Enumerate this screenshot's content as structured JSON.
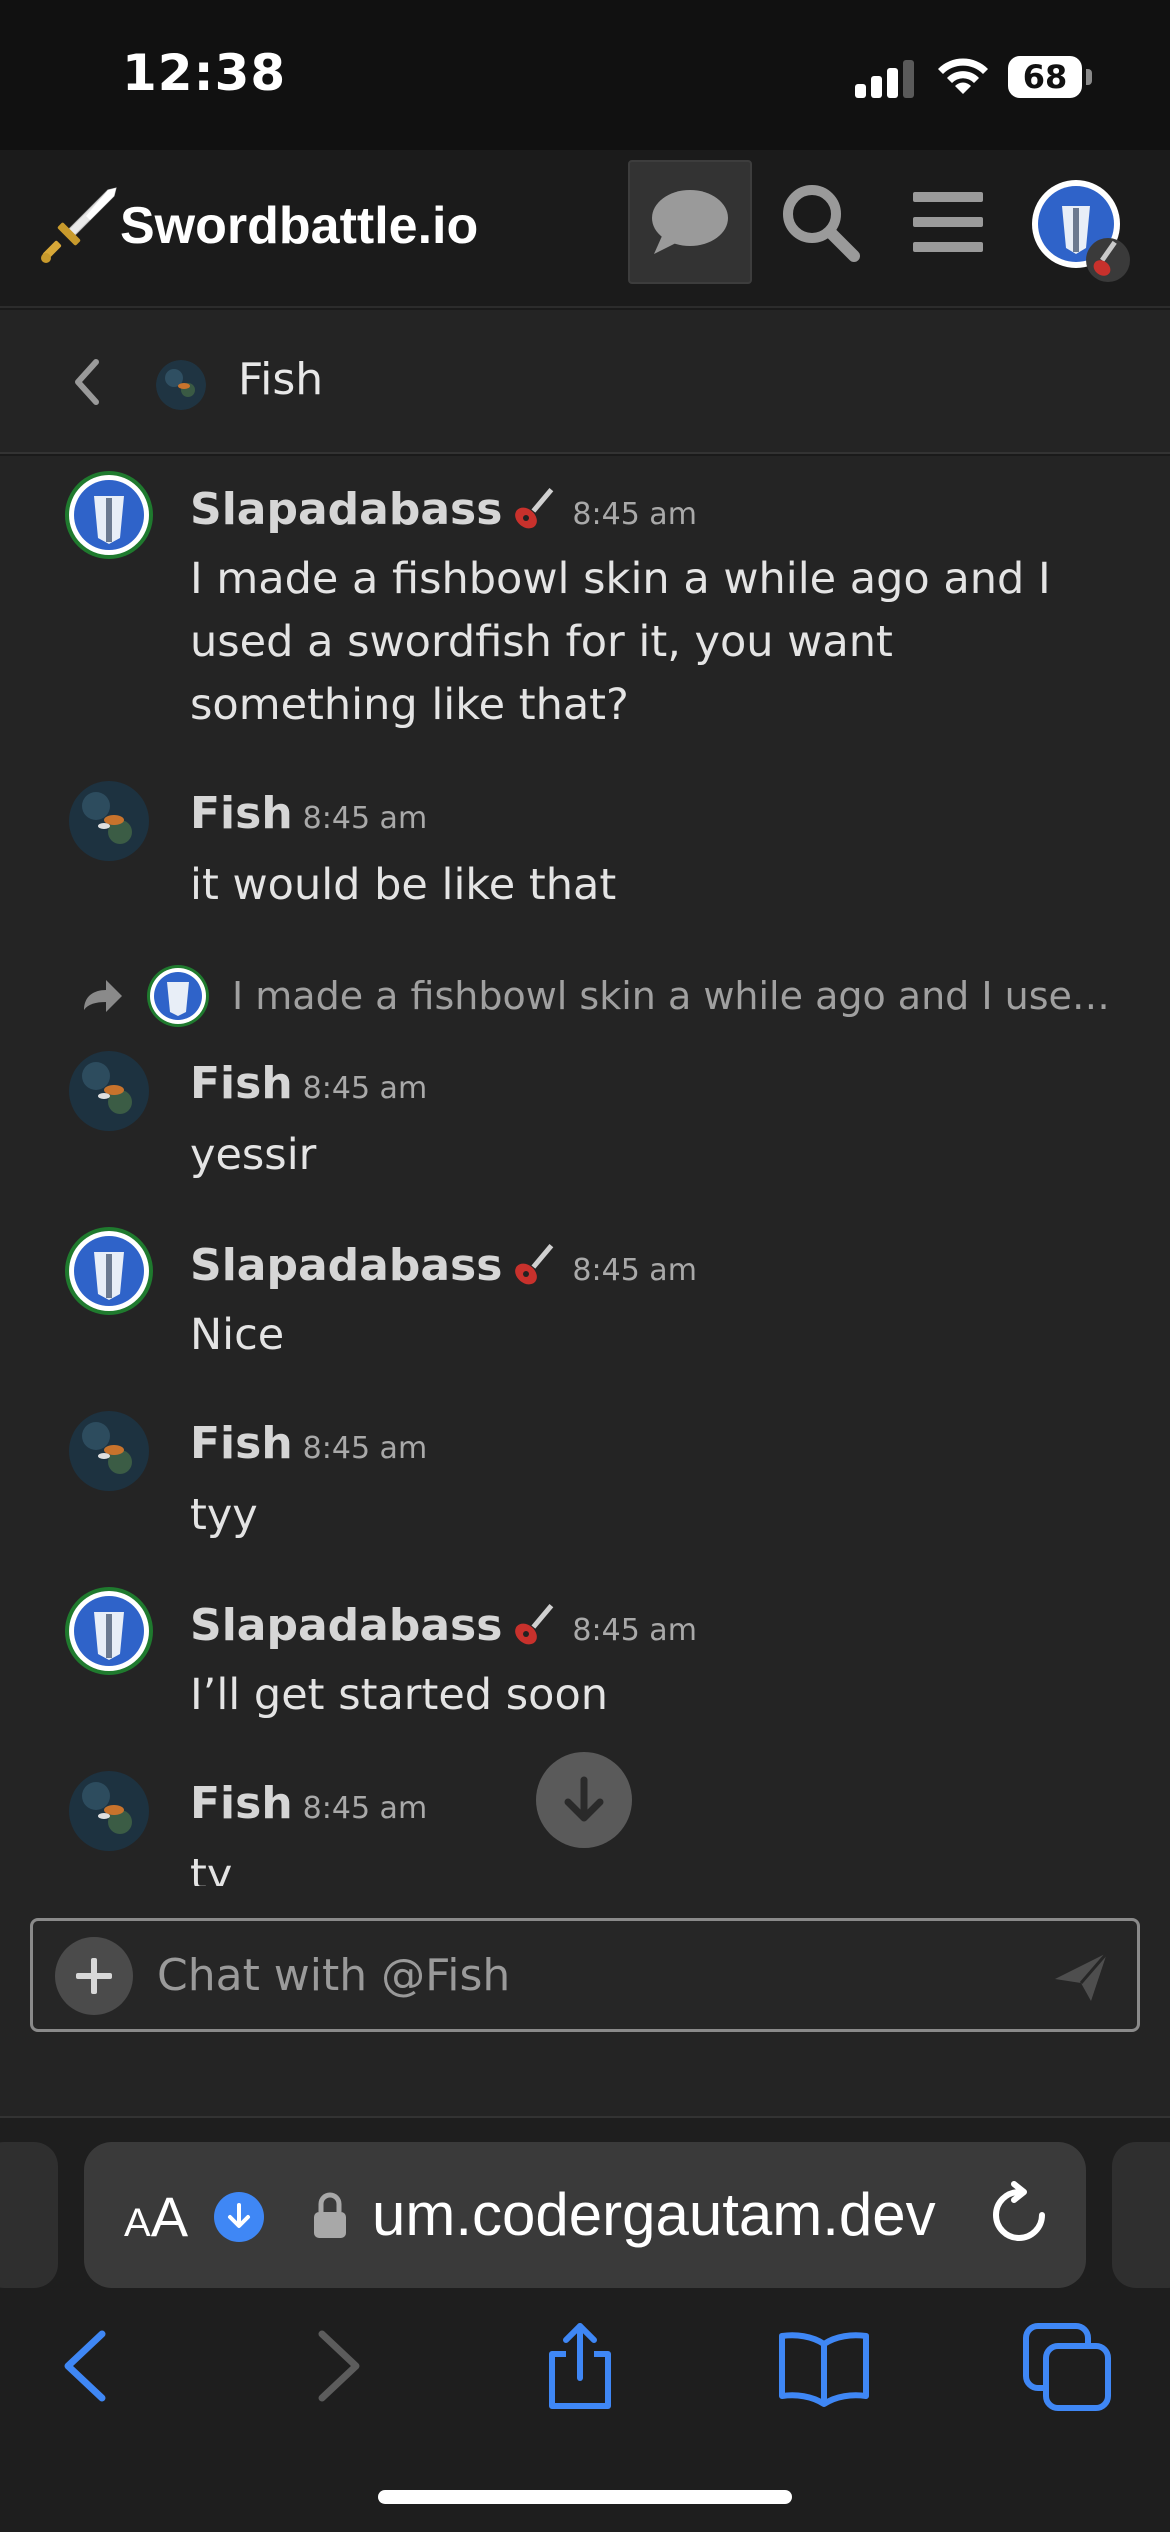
{
  "status_bar": {
    "time": "12:38",
    "battery_percent": "68",
    "signal_bars": 3,
    "icons": [
      "signal-icon",
      "wifi-icon",
      "battery-icon"
    ]
  },
  "forum_header": {
    "brand": "Swordbattle.io",
    "buttons": [
      "chat-icon",
      "search-icon",
      "hamburger-menu-icon",
      "user-avatar"
    ]
  },
  "channel": {
    "title": "Fish"
  },
  "messages": [
    {
      "author": "Slapadabass",
      "flair": "guitar-icon",
      "time": "8:45 am",
      "text": "I made a fishbowl skin a while ago and I used a swordfish for it, you want something like that?"
    },
    {
      "author": "Fish",
      "time": "8:45 am",
      "text": "it would be like that"
    },
    {
      "author": "Fish",
      "time": "8:45 am",
      "text": "yessir",
      "reply_preview": "I made a fishbowl skin a while ago and I used a s…"
    },
    {
      "author": "Slapadabass",
      "flair": "guitar-icon",
      "time": "8:45 am",
      "text": "Nice"
    },
    {
      "author": "Fish",
      "time": "8:45 am",
      "text": "tyy"
    },
    {
      "author": "Slapadabass",
      "flair": "guitar-icon",
      "time": "8:45 am",
      "text": "I’ll get started soon"
    },
    {
      "author": "Fish",
      "time": "8:45 am",
      "text": "ty"
    }
  ],
  "composer": {
    "placeholder": "Chat with @Fish"
  },
  "browser": {
    "aa_small": "A",
    "aa_big": "A",
    "url": "um.codergautam.dev",
    "toolbar": [
      "back-icon",
      "forward-icon",
      "share-icon",
      "bookmarks-icon",
      "tabs-icon"
    ]
  },
  "colors": {
    "accent_blue": "#3f87f5",
    "background": "#242424",
    "header": "#1b1b1b"
  }
}
